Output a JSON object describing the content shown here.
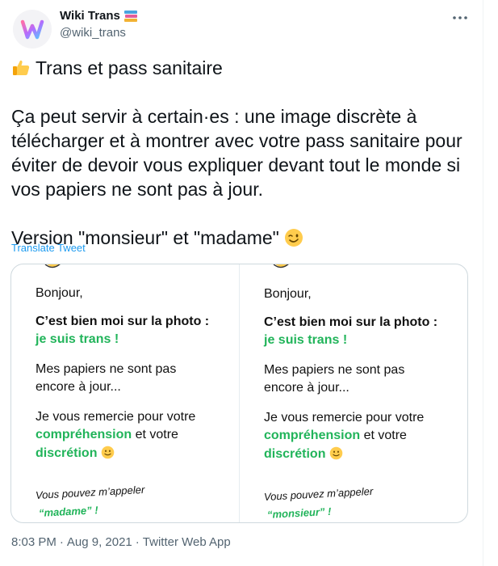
{
  "author": {
    "display_name": "Wiki Trans",
    "handle": "@wiki_trans",
    "avatar_icon": "wiki-trans-logo",
    "badge_icon": "books-emoji",
    "more_icon": "more-horizontal-icon"
  },
  "tweet": {
    "title": "Trans et pass sanitaire",
    "title_icon": "thumbs-up-emoji",
    "body": "Ça peut servir à certain·es : une image discrète à télécharger et à montrer avec votre pass sanitaire pour éviter de devoir vous expliquer devant tout le monde si vos papiers ne sont pas à jour.",
    "body_lines": [
      "Ça peut servir à certain·es : une image discrète à",
      "télécharger et à montrer avec votre pass sanitaire pour",
      "éviter de devoir vous expliquer devant tout le monde si",
      "vos papiers ne sont pas à jour."
    ],
    "closing": "Version \"monsieur\" et \"madame\"",
    "closing_icon": "winking-face-emoji",
    "translate_label": "Translate Tweet"
  },
  "media": [
    {
      "greeting": "Bonjour,",
      "photo_line": "C’est bien moi sur la photo :",
      "trans_line": "je suis trans !",
      "papers_line1": "Mes papiers ne sont pas",
      "papers_line2": "encore à jour...",
      "thanks_line1": "Je vous remercie pour votre",
      "thanks_word1": "compréhension",
      "thanks_and": " et votre",
      "thanks_word2": "discrétion",
      "call_line": "Vous pouvez m’appeler",
      "call_name": "“madame” !"
    },
    {
      "greeting": "Bonjour,",
      "photo_line": "C’est bien moi sur la photo :",
      "trans_line": "je suis trans !",
      "papers_line1": "Mes papiers ne sont pas",
      "papers_line2": "encore à jour...",
      "thanks_line1": "Je vous remercie pour votre",
      "thanks_word1": "compréhension",
      "thanks_and": " et votre",
      "thanks_word2": "discrétion",
      "call_line": "Vous pouvez m’appeler",
      "call_name": "“monsieur” !"
    }
  ],
  "meta": {
    "time": "8:03 PM",
    "date": "Aug 9, 2021",
    "separator": "·",
    "source": "Twitter Web App"
  },
  "colors": {
    "link": "#1d9bf0",
    "highlight_green": "#21b45a",
    "secondary_text": "#536471",
    "border": "#cfd9de"
  }
}
